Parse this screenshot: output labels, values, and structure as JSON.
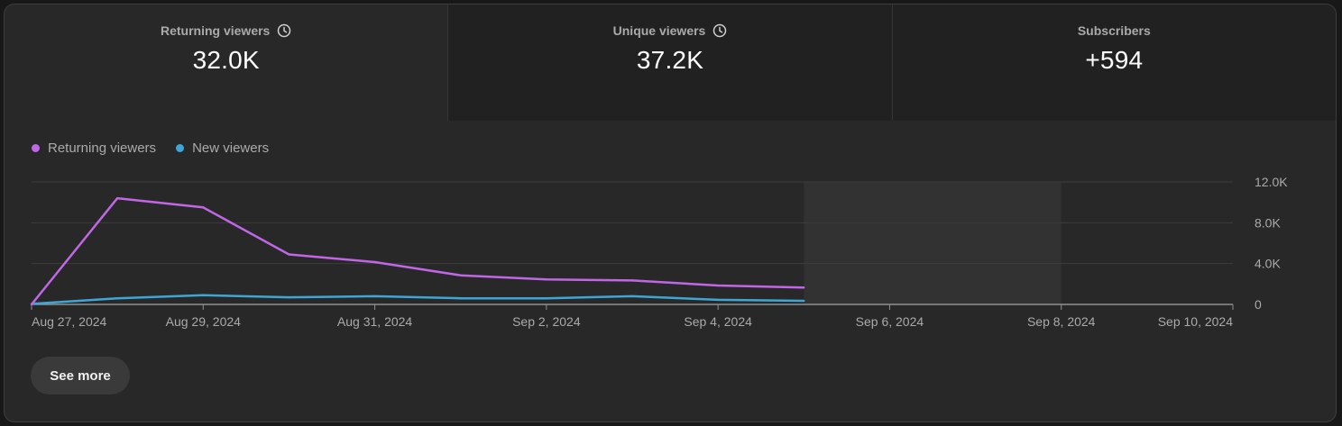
{
  "metrics": [
    {
      "label": "Returning viewers",
      "value": "32.0K",
      "has_clock": true
    },
    {
      "label": "Unique viewers",
      "value": "37.2K",
      "has_clock": true
    },
    {
      "label": "Subscribers",
      "value": "+594",
      "has_clock": false
    }
  ],
  "legend": [
    {
      "label": "Returning viewers",
      "color": "#c067e6"
    },
    {
      "label": "New viewers",
      "color": "#3ea6d6"
    }
  ],
  "see_more_label": "See more",
  "chart_data": {
    "type": "line",
    "x_dates": [
      "Aug 27",
      "Aug 28",
      "Aug 29",
      "Aug 30",
      "Aug 31",
      "Sep 1",
      "Sep 2",
      "Sep 3",
      "Sep 4",
      "Sep 5"
    ],
    "series": [
      {
        "name": "Returning viewers",
        "color": "#c067e6",
        "values": [
          0,
          10400,
          9500,
          4900,
          4150,
          2850,
          2450,
          2350,
          1850,
          1650
        ]
      },
      {
        "name": "New viewers",
        "color": "#3ea6d6",
        "values": [
          50,
          600,
          900,
          700,
          800,
          600,
          600,
          800,
          450,
          350
        ]
      }
    ],
    "x_tick_labels": [
      "Aug 27, 2024",
      "Aug 29, 2024",
      "Aug 31, 2024",
      "Sep 2, 2024",
      "Sep 4, 2024",
      "Sep 6, 2024",
      "Sep 8, 2024",
      "Sep 10, 2024"
    ],
    "y_tick_labels": [
      "0",
      "4.0K",
      "8.0K",
      "12.0K"
    ],
    "y_ticks": [
      0,
      4000,
      8000,
      12000
    ],
    "ylim": [
      0,
      12000
    ],
    "x_range": [
      "Aug 27, 2024",
      "Sep 10, 2024"
    ],
    "shaded_period": [
      "Sep 5, 2024",
      "Sep 8, 2024"
    ],
    "grid": true
  }
}
